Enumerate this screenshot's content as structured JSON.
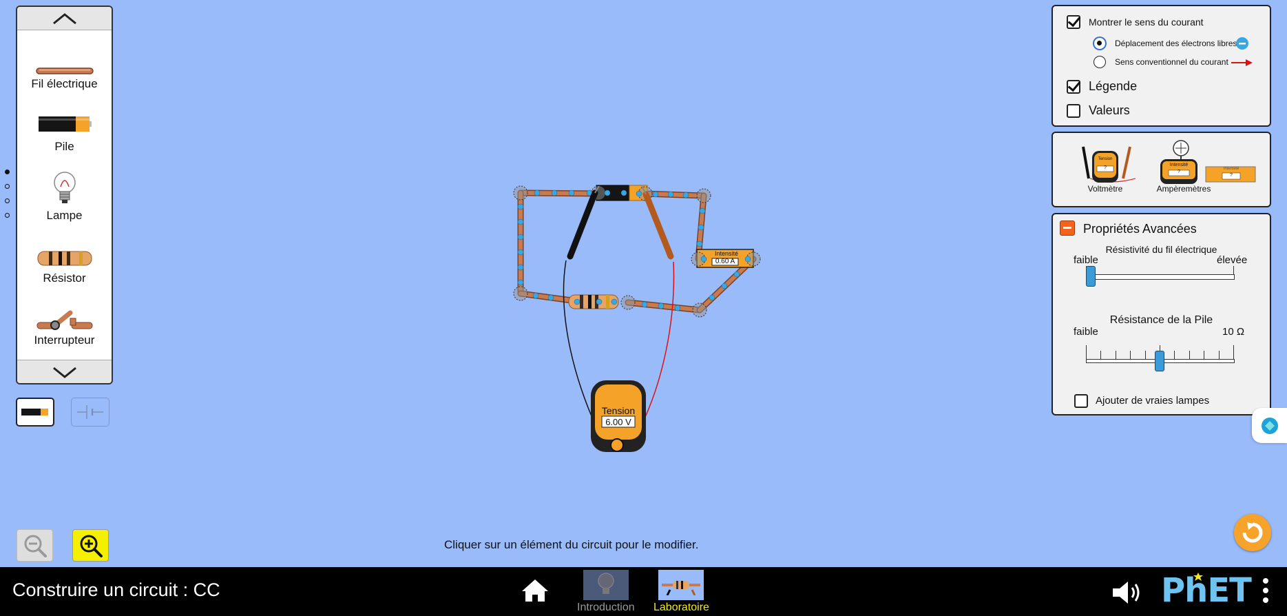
{
  "toolbox": {
    "items": [
      {
        "label": "Fil électrique",
        "icon": "wire-icon"
      },
      {
        "label": "Pile",
        "icon": "battery-icon"
      },
      {
        "label": "Lampe",
        "icon": "lightbulb-icon"
      },
      {
        "label": "Résistor",
        "icon": "resistor-icon"
      },
      {
        "label": "Interrupteur",
        "icon": "switch-icon"
      }
    ],
    "page_dots": 4,
    "active_page": 0
  },
  "display_panel": {
    "show_current_label": "Montrer le sens du courant",
    "show_current_checked": true,
    "electrons_label": "Déplacement des électrons libres",
    "electrons_selected": true,
    "conventional_label": "Sens conventionnel du courant",
    "conventional_selected": false,
    "labels_label": "Légende",
    "labels_checked": true,
    "values_label": "Valeurs",
    "values_checked": false
  },
  "meters_panel": {
    "voltmeter_label": "Voltmètre",
    "ammeters_label": "Ampèremètres",
    "voltmeter_icon_text": "Tension",
    "voltmeter_icon_value": "?",
    "ammeter_icon_text": "Intensité",
    "ammeter_icon_value": "?"
  },
  "advanced_panel": {
    "title": "Propriétés Avancées",
    "wire_resistivity": {
      "label": "Résistivité du fil électrique",
      "min_label": "faible",
      "max_label": "élevée",
      "value_fraction": 0.0
    },
    "battery_resistance": {
      "label": "Résistance de la Pile",
      "min_label": "faible",
      "max_label": "10 Ω",
      "value_fraction": 0.5
    },
    "real_bulbs_label": "Ajouter de vraies lampes",
    "real_bulbs_checked": false
  },
  "circuit": {
    "ammeter_label": "Intensité",
    "ammeter_reading": "0.60 A",
    "voltmeter_label": "Tension",
    "voltmeter_reading": "6.00 V"
  },
  "status_text": "Cliquer sur un élément du circuit pour le modifier.",
  "navbar": {
    "sim_title": "Construire un circuit : CC",
    "screens": [
      {
        "label": "Introduction",
        "active": false
      },
      {
        "label": "Laboratoire",
        "active": true
      }
    ],
    "brand": "PhET"
  },
  "colors": {
    "background": "#99bbfa",
    "active_screen": "#f2e916",
    "inactive_screen": "#999999",
    "reset": "#f6a22b",
    "zoom_in": "#f5f000",
    "phet_blue": "#6fc3f0"
  }
}
